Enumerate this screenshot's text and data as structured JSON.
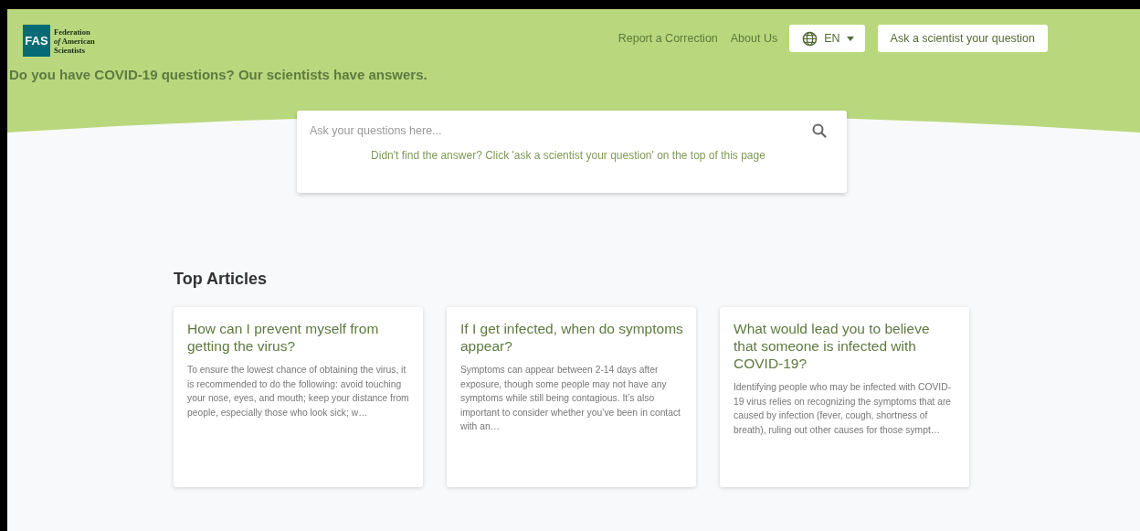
{
  "header": {
    "logo": {
      "mark": "FAS",
      "lines": [
        "Federation",
        "*of* American",
        "Scientists"
      ]
    },
    "nav_links": [
      "Report a Correction",
      "About Us"
    ],
    "language": {
      "label": "EN"
    },
    "ask_button": "Ask a scientist your question",
    "tagline": "Do you have COVID-19 questions? Our scientists have answers."
  },
  "search": {
    "placeholder": "Ask your questions here...",
    "hint": "Didn't find the answer? Click 'ask a scientist your question' on the top of this page"
  },
  "top_articles": {
    "heading": "Top Articles",
    "articles": [
      {
        "title": "How can I prevent myself from getting the virus?",
        "excerpt": "To ensure the lowest chance of obtaining the virus, it is recommended to do the following: avoid touching your nose, eyes, and mouth; keep your distance from people, especially those who look sick; w…"
      },
      {
        "title": "If I get infected, when do symptoms appear?",
        "excerpt": "Symptoms can appear between 2-14 days after exposure, though some people may not have any symptoms while still being contagious. It’s also important to consider whether you’ve been in contact with an…"
      },
      {
        "title": "What would lead you to believe that someone is infected with COVID-19?",
        "excerpt": "Identifying people who may be infected with COVID-19 virus relies on recognizing the symptoms that are caused by infection (fever, cough, shortness of breath), ruling out other causes for those sympt…"
      }
    ]
  }
}
